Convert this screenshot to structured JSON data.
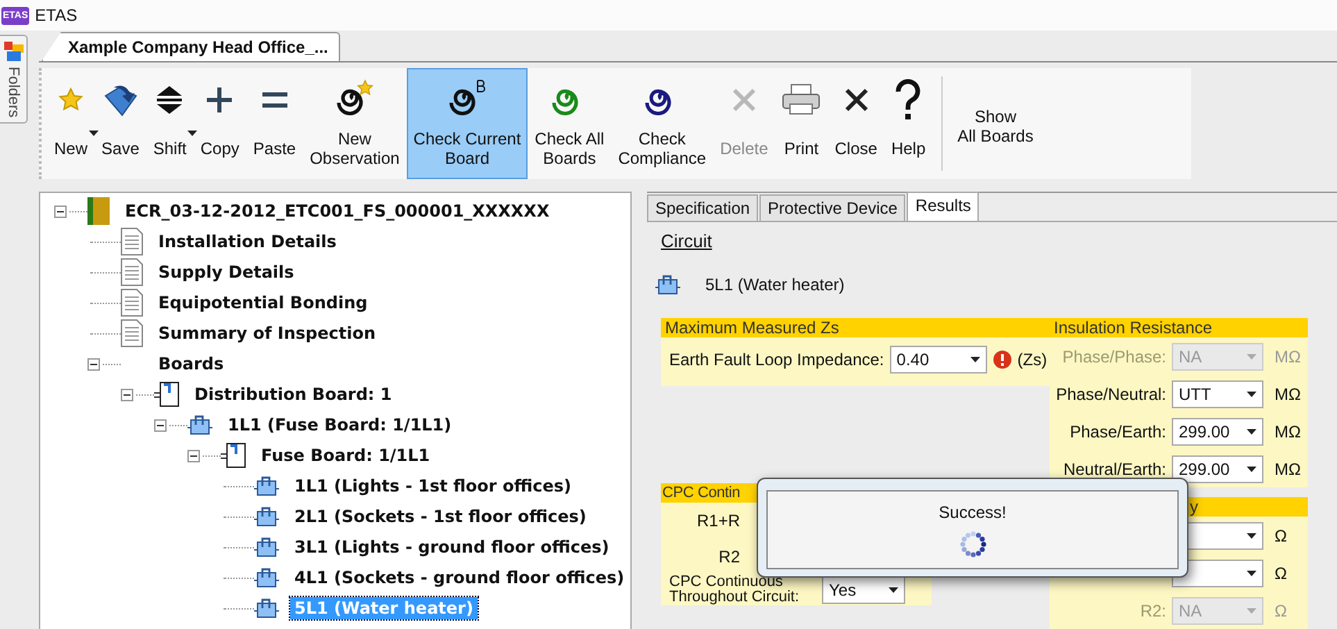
{
  "window": {
    "logo": "ETAS",
    "title": "ETAS"
  },
  "folders_pane": {
    "label": "Folders"
  },
  "document_tab": {
    "label": "Xample Company Head Office_..."
  },
  "toolbar": {
    "buttons": [
      {
        "lines": [
          "New"
        ],
        "kind": "star",
        "dropdown": true,
        "disabled": false,
        "selected": false
      },
      {
        "lines": [
          "Save"
        ],
        "kind": "save",
        "dropdown": false,
        "disabled": false,
        "selected": false
      },
      {
        "lines": [
          "Shift"
        ],
        "kind": "shift",
        "dropdown": true,
        "disabled": false,
        "selected": false
      },
      {
        "lines": [
          "Copy"
        ],
        "kind": "plus",
        "dropdown": false,
        "disabled": false,
        "selected": false
      },
      {
        "lines": [
          "Paste"
        ],
        "kind": "equals",
        "dropdown": false,
        "disabled": false,
        "selected": false
      },
      {
        "lines": [
          "New",
          "Observation"
        ],
        "kind": "observation",
        "dropdown": false,
        "disabled": false,
        "selected": false
      },
      {
        "lines": [
          "Check Current",
          "Board"
        ],
        "kind": "checkboard",
        "dropdown": false,
        "disabled": false,
        "selected": true
      },
      {
        "lines": [
          "Check All",
          "Boards"
        ],
        "kind": "checkall",
        "dropdown": false,
        "disabled": false,
        "selected": false
      },
      {
        "lines": [
          "Check",
          "Compliance"
        ],
        "kind": "compliance",
        "dropdown": false,
        "disabled": false,
        "selected": false
      },
      {
        "lines": [
          "Delete"
        ],
        "kind": "cross",
        "dropdown": false,
        "disabled": true,
        "selected": false
      },
      {
        "lines": [
          "Print"
        ],
        "kind": "printer",
        "dropdown": false,
        "disabled": false,
        "selected": false
      },
      {
        "lines": [
          "Close"
        ],
        "kind": "cross",
        "dropdown": false,
        "disabled": false,
        "selected": false
      },
      {
        "lines": [
          "Help"
        ],
        "kind": "question",
        "dropdown": false,
        "disabled": false,
        "selected": false
      }
    ],
    "side_button": {
      "lines": [
        "Show",
        "All Boards"
      ]
    }
  },
  "tree": {
    "items": [
      {
        "label": "ECR_03-12-2012_ETC001_FS_000001_XXXXXX",
        "kind": "report",
        "expanded": true,
        "selected": false,
        "children": [
          {
            "label": "Installation Details",
            "kind": "document",
            "selected": false
          },
          {
            "label": "Supply Details",
            "kind": "document",
            "selected": false
          },
          {
            "label": "Equipotential Bonding",
            "kind": "document",
            "selected": false
          },
          {
            "label": "Summary of Inspection",
            "kind": "document",
            "selected": false
          },
          {
            "label": "Boards",
            "kind": "folder",
            "expanded": true,
            "selected": false,
            "children": [
              {
                "label": "Distribution Board: 1",
                "kind": "board",
                "expanded": true,
                "selected": false,
                "children": [
                  {
                    "label": "1L1 (Fuse Board: 1/1L1)",
                    "kind": "circuit",
                    "expanded": true,
                    "selected": false,
                    "children": [
                      {
                        "label": "Fuse Board: 1/1L1",
                        "kind": "board",
                        "expanded": true,
                        "selected": false,
                        "children": [
                          {
                            "label": "1L1 (Lights - 1st floor offices)",
                            "kind": "circuit",
                            "selected": false
                          },
                          {
                            "label": "2L1 (Sockets - 1st floor offices)",
                            "kind": "circuit",
                            "selected": false
                          },
                          {
                            "label": "3L1 (Lights - ground floor offices)",
                            "kind": "circuit",
                            "selected": false
                          },
                          {
                            "label": "4L1 (Sockets - ground floor offices)",
                            "kind": "circuit",
                            "selected": false
                          },
                          {
                            "label": "5L1 (Water heater)",
                            "kind": "circuit",
                            "selected": true
                          }
                        ]
                      }
                    ]
                  }
                ]
              }
            ]
          }
        ]
      }
    ]
  },
  "detail": {
    "tabs": [
      {
        "label": "Specification",
        "selected": false
      },
      {
        "label": "Protective Device",
        "selected": false
      },
      {
        "label": "Results",
        "selected": true
      }
    ],
    "circuit_link": "Circuit",
    "circuit_name": "5L1 (Water heater)",
    "zs_section": {
      "title": "Maximum Measured Zs",
      "label": "Earth Fault Loop Impedance:",
      "value": "0.40",
      "warning": true,
      "unit": "(Zs)"
    },
    "insulation_section": {
      "title": "Insulation Resistance",
      "rows": [
        {
          "label": "Phase/Phase:",
          "value": "NA",
          "disabled": true,
          "unit": "MΩ"
        },
        {
          "label": "Phase/Neutral:",
          "value": "UTT",
          "disabled": false,
          "unit": "MΩ"
        },
        {
          "label": "Phase/Earth:",
          "value": "299.00",
          "disabled": false,
          "unit": "MΩ"
        },
        {
          "label": "Neutral/Earth:",
          "value": "299.00",
          "disabled": false,
          "unit": "MΩ"
        }
      ]
    },
    "continuity_section": {
      "title": "CPC Contin",
      "rows": [
        {
          "label": "R1+R"
        },
        {
          "label": "R2"
        }
      ],
      "continuous_label": "CPC Continuous Throughout Circuit:",
      "continuous_value": "Yes"
    },
    "right_section": {
      "title": "y",
      "rows": [
        {
          "disabled": false,
          "unit": "Ω"
        },
        {
          "disabled": false,
          "unit": "Ω"
        },
        {
          "label": "R2:",
          "value": "NA",
          "disabled": true,
          "unit": "Ω"
        }
      ]
    }
  },
  "dialog": {
    "message": "Success!"
  }
}
